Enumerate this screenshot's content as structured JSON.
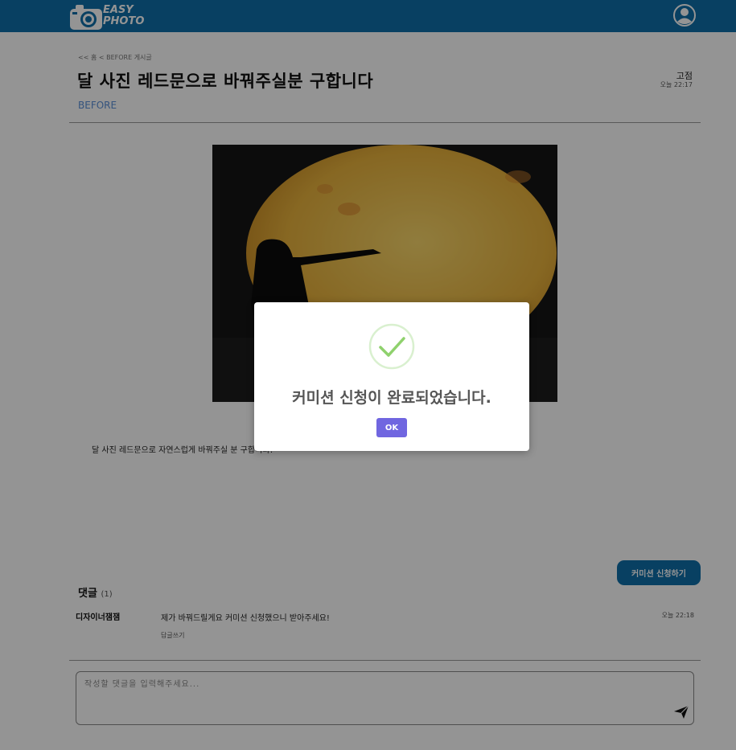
{
  "header": {
    "logo_line1": "EASY",
    "logo_line2": "PHOTO",
    "brand_color": "#0f6fa9"
  },
  "post": {
    "breadcrumb": "<< 홈 < BEFORE 게시글",
    "title": "달 사진 레드문으로 바꿔주실분 구합니다",
    "author": "고점",
    "time": "오늘 22:17",
    "category": "BEFORE",
    "body": "달 사진 레드문으로 자연스럽게 바꿔주실 분 구합니다!"
  },
  "actions": {
    "commission_button": "커미션 신청하기"
  },
  "comments": {
    "heading": "댓글",
    "count": "(1)",
    "items": [
      {
        "author": "디자이너잼잼",
        "text": "제가 바꿔드릴게요 커미션 신청했으니 받아주세요!",
        "time": "오늘 22:18",
        "reply_label": "답글쓰기"
      }
    ],
    "input_placeholder": "작성할 댓글을 입력해주세요..."
  },
  "modal": {
    "message": "커미션 신청이 완료되었습니다.",
    "ok_label": "OK",
    "icon": "check-circle-icon",
    "ok_color": "#7066e0"
  }
}
